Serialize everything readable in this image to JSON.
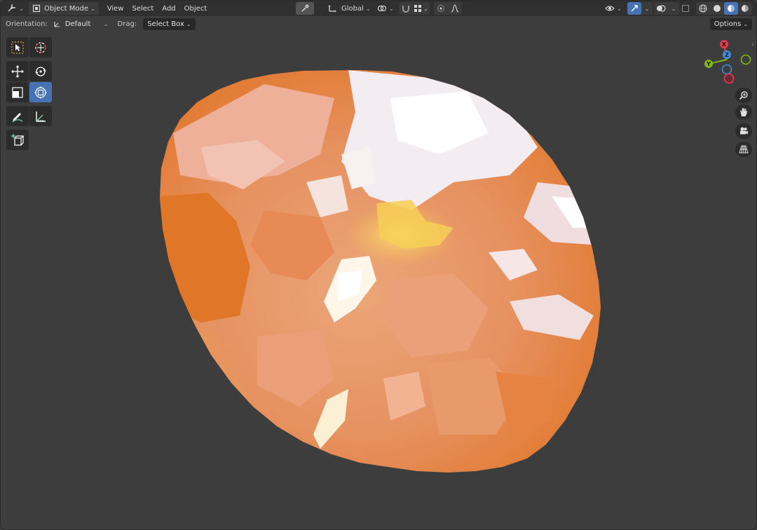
{
  "header": {
    "mode_label": "Object Mode",
    "menu": [
      "View",
      "Select",
      "Add",
      "Object"
    ],
    "transform_orientation": "Global"
  },
  "tool_settings": {
    "orientation_label": "Orientation:",
    "orientation_value": "Default",
    "drag_label": "Drag:",
    "drag_value": "Select Box",
    "options_label": "Options"
  },
  "gizmo": {
    "x_label": "X",
    "y_label": "Y",
    "z_label": "Z"
  },
  "icons": {
    "editor_type": "axes-editor-icon",
    "mode": "object-mode-icon",
    "eyedropper": "eyedropper-icon",
    "proportional": "proportional-falloff-icon",
    "snap": "magnet-icon",
    "visibility": "visibility-icon",
    "gizmos": "gizmo-icon",
    "overlays": "overlay-icon",
    "xray": "xray-icon",
    "shading": [
      "wireframe-shading-icon",
      "solid-shading-icon",
      "material-preview-icon",
      "rendered-shading-icon"
    ],
    "nav": [
      "zoom-icon",
      "hand-pan-icon",
      "camera-icon",
      "grid-perspective-icon"
    ]
  },
  "colors": {
    "accent": "#4772b3",
    "axis_x": "#e83a4f",
    "axis_y": "#7fb718",
    "axis_z": "#3f8ce0"
  }
}
